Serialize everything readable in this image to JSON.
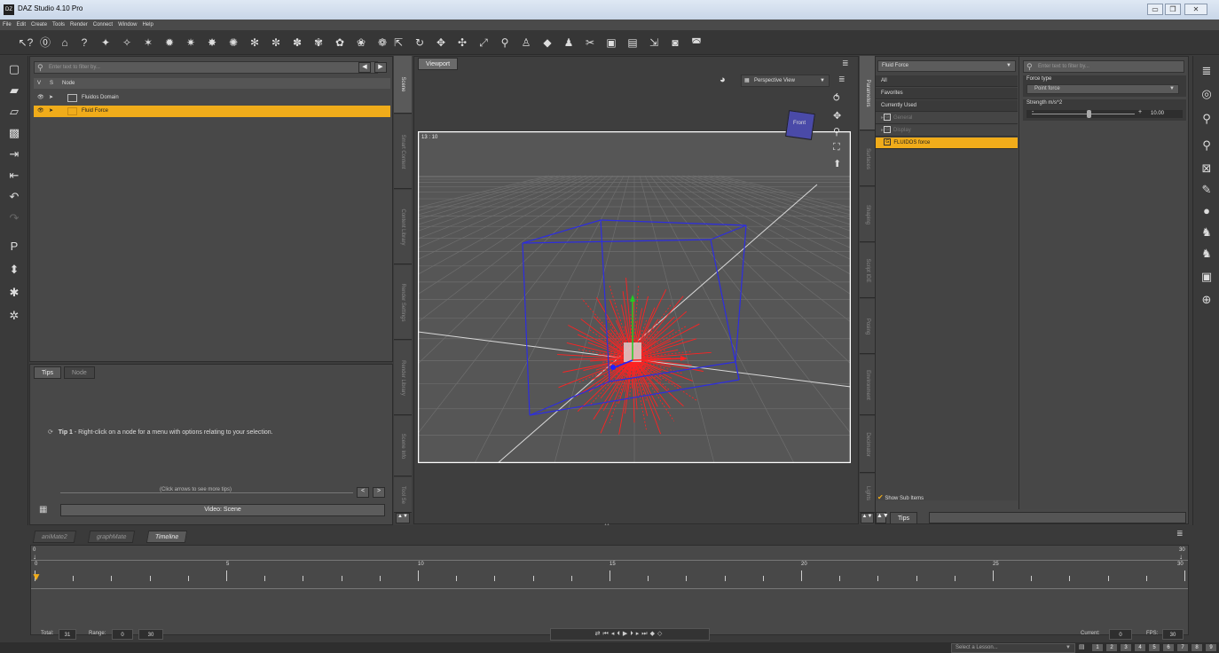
{
  "window": {
    "title": "DAZ Studio 4.10 Pro",
    "app_icon": "DZ"
  },
  "menu": [
    "File",
    "Edit",
    "Create",
    "Tools",
    "Render",
    "Connect",
    "Window",
    "Help"
  ],
  "scene_panel": {
    "filter_placeholder": "Enter text to filter by...",
    "columns": {
      "v": "V",
      "s": "S",
      "node": "Node"
    },
    "nodes": [
      {
        "label": "Fluidos Domain",
        "selected": false
      },
      {
        "label": "Fluid Force",
        "selected": true
      }
    ]
  },
  "left_vtabs": [
    "Scene",
    "Smart Content",
    "Content Library",
    "Render Settings",
    "Render Library",
    "Scene Info",
    "Tool Se"
  ],
  "tips_panel": {
    "tabs": [
      "Tips",
      "Node"
    ],
    "tip_number": "Tip 1",
    "tip_text": " - Right-click on a node for a menu with options relating to your selection.",
    "nav_hint": "(Click arrows to see more tips)",
    "prev": "<",
    "next": ">",
    "video_button": "Video: Scene"
  },
  "viewport": {
    "tab": "Viewport",
    "view_dropdown": "Perspective View",
    "aspect_label": "13 : 10",
    "cube_label": "Front",
    "colors": {
      "bbox": "#2d2de0",
      "force": "#ff2222",
      "grid": "#6e6e6e",
      "frame": "#ffffff"
    }
  },
  "right_vtabs": [
    "Parameters",
    "Surfaces",
    "Shaping",
    "Script IDE",
    "Posing",
    "Environment",
    "Decimator",
    "Lights"
  ],
  "parameters": {
    "node_dropdown": "Fluid Force",
    "categories": [
      {
        "label": "All",
        "state": "normal"
      },
      {
        "label": "Favorites",
        "state": "normal"
      },
      {
        "label": "Currently Used",
        "state": "normal"
      },
      {
        "label": "General",
        "state": "dim",
        "group": true
      },
      {
        "label": "Display",
        "state": "dim",
        "group": true
      },
      {
        "label": "FLUIDOS force",
        "state": "selected",
        "group": true
      }
    ],
    "show_sub_items": "Show Sub Items",
    "filter_placeholder": "Enter text to filter by...",
    "force_type_label": "Force type",
    "force_type_value": "Point force",
    "strength_label": "Strength  m/s^2",
    "strength_value": "10.00",
    "strength_fraction": 0.55,
    "tips_tab": "Tips"
  },
  "timeline": {
    "tabs": [
      "aniMate2",
      "graphMate",
      "Timeline"
    ],
    "range_start": "0",
    "range_end": "30",
    "ticks": [
      "0",
      "5",
      "10",
      "15",
      "20",
      "25",
      "30"
    ],
    "total_label": "Total:",
    "total": "31",
    "range_label": "Range:",
    "range_from": "0",
    "range_to": "30",
    "current_label": "Current:",
    "current": "0",
    "fps_label": "FPS:",
    "fps": "30"
  },
  "lesson": {
    "placeholder": "Select a Lesson...",
    "pages": [
      "1",
      "2",
      "3",
      "4",
      "5",
      "6",
      "7",
      "8",
      "9"
    ]
  }
}
